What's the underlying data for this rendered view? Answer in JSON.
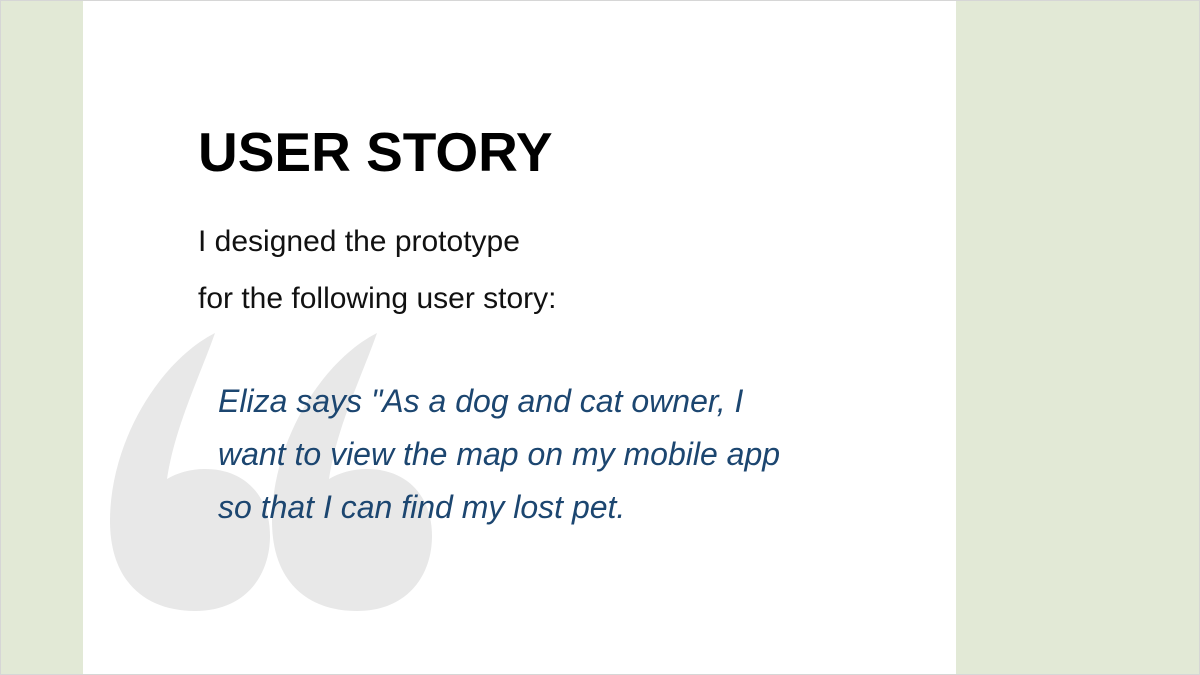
{
  "slide": {
    "title": "USER STORY",
    "intro_lines": [
      "I designed the prototype",
      "for the following user story:"
    ],
    "quote_lines": [
      "Eliza says \"As a dog and cat owner, I",
      "want to view the map on my mobile app",
      "so that I can find my lost pet."
    ],
    "colors": {
      "side_background": "#e2e9d6",
      "panel_background": "#ffffff",
      "title": "#000000",
      "quote_text": "#1c4670",
      "quote_mark": "#e8e8e8"
    },
    "icons": {
      "quote_mark": "left-double-quotation-icon"
    }
  }
}
